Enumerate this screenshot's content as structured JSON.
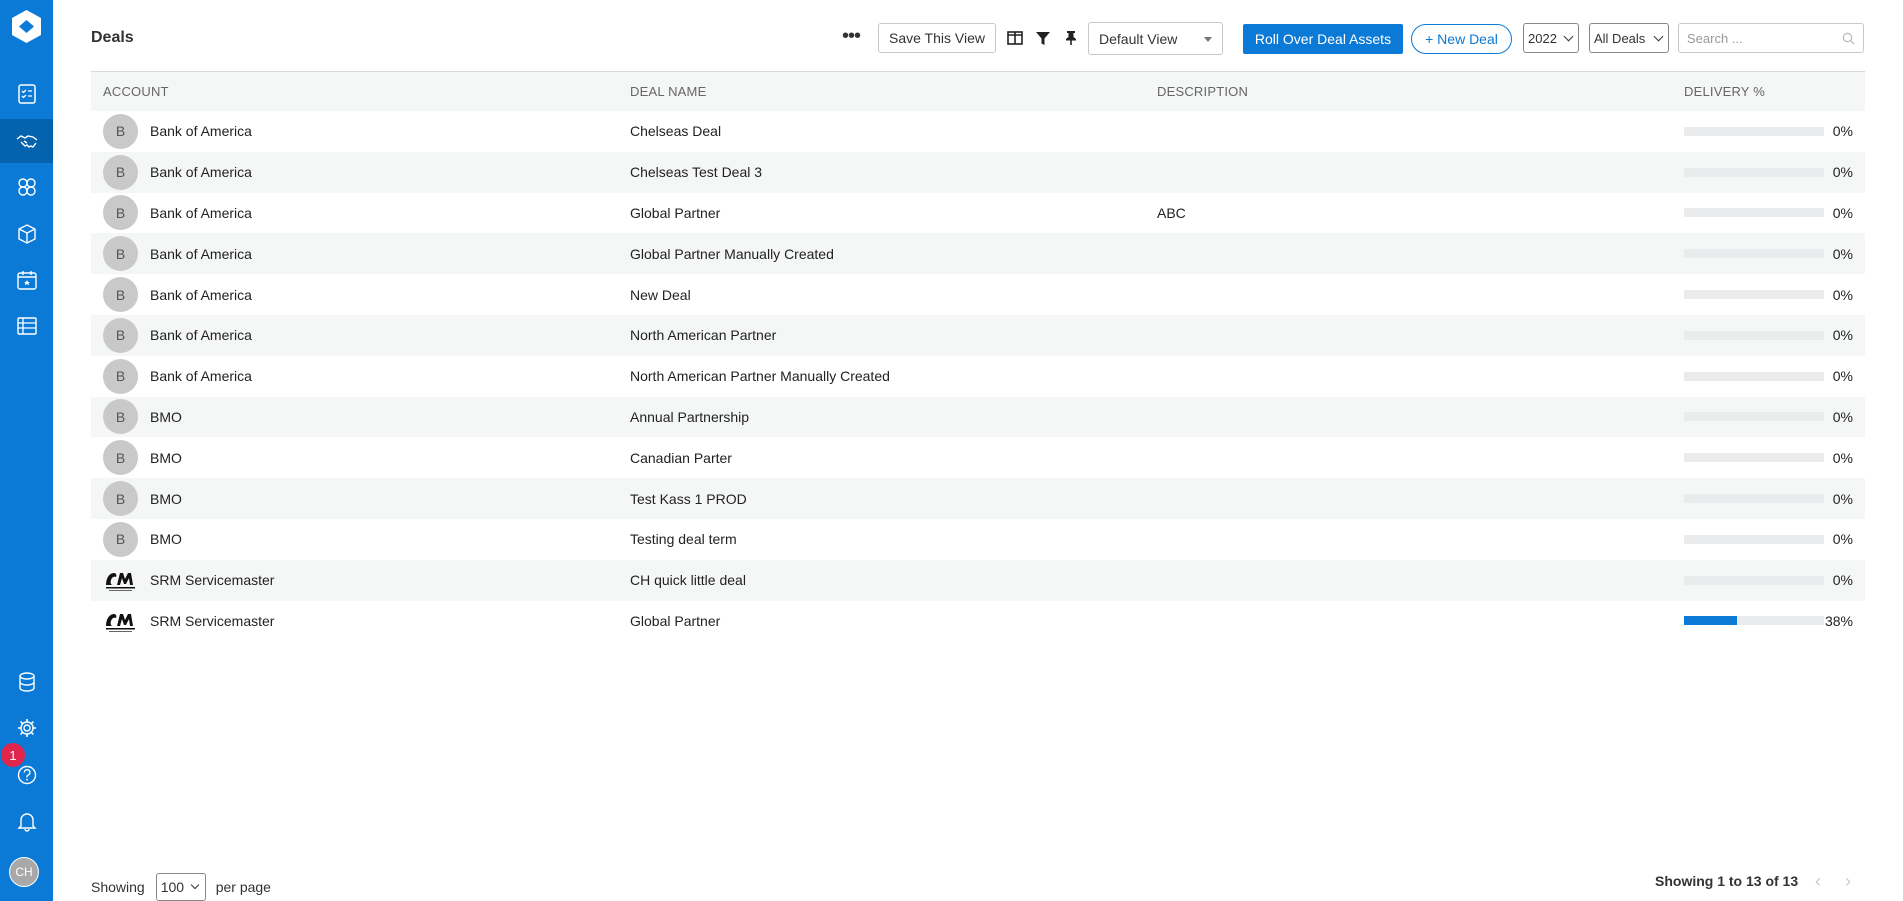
{
  "page": {
    "title": "Deals"
  },
  "sidebar": {
    "icons": [
      "checklist-icon",
      "handshake-icon",
      "accounts-icon",
      "assets-icon",
      "calendar-icon",
      "list-icon",
      "database-icon",
      "gear-icon",
      "help-icon",
      "bell-icon"
    ],
    "badge_count": "1",
    "user_initials": "CH",
    "accent": "#0a7ad6"
  },
  "toolbar": {
    "more_label": "•••",
    "save_view_label": "Save This View",
    "view_select": "Default View",
    "roll_over_label": "Roll Over Deal Assets",
    "new_deal_label": "+ New Deal",
    "year_select": "2022",
    "scope_select": "All Deals",
    "search_placeholder": "Search ..."
  },
  "table": {
    "headers": {
      "account": "ACCOUNT",
      "deal_name": "DEAL NAME",
      "description": "DESCRIPTION",
      "delivery": "DELIVERY %"
    },
    "rows": [
      {
        "avatar": "B",
        "account": "Bank of America",
        "deal": "Chelseas Deal",
        "description": "",
        "delivery": 0,
        "delivery_label": "0%"
      },
      {
        "avatar": "B",
        "account": "Bank of America",
        "deal": "Chelseas Test Deal 3",
        "description": "",
        "delivery": 0,
        "delivery_label": "0%"
      },
      {
        "avatar": "B",
        "account": "Bank of America",
        "deal": "Global Partner",
        "description": "ABC",
        "delivery": 0,
        "delivery_label": "0%"
      },
      {
        "avatar": "B",
        "account": "Bank of America",
        "deal": "Global Partner Manually Created",
        "description": "",
        "delivery": 0,
        "delivery_label": "0%"
      },
      {
        "avatar": "B",
        "account": "Bank of America",
        "deal": "New Deal",
        "description": "",
        "delivery": 0,
        "delivery_label": "0%"
      },
      {
        "avatar": "B",
        "account": "Bank of America",
        "deal": "North American Partner",
        "description": "",
        "delivery": 0,
        "delivery_label": "0%"
      },
      {
        "avatar": "B",
        "account": "Bank of America",
        "deal": "North American Partner Manually Created",
        "description": "",
        "delivery": 0,
        "delivery_label": "0%"
      },
      {
        "avatar": "B",
        "account": "BMO",
        "deal": "Annual Partnership",
        "description": "",
        "delivery": 0,
        "delivery_label": "0%"
      },
      {
        "avatar": "B",
        "account": "BMO",
        "deal": "Canadian Parter",
        "description": "",
        "delivery": 0,
        "delivery_label": "0%"
      },
      {
        "avatar": "B",
        "account": "BMO",
        "deal": "Test Kass 1 PROD",
        "description": "",
        "delivery": 0,
        "delivery_label": "0%"
      },
      {
        "avatar": "B",
        "account": "BMO",
        "deal": "Testing deal term",
        "description": "",
        "delivery": 0,
        "delivery_label": "0%"
      },
      {
        "avatar": "logo",
        "account": "SRM Servicemaster",
        "deal": "CH quick little deal",
        "description": "",
        "delivery": 0,
        "delivery_label": "0%"
      },
      {
        "avatar": "logo",
        "account": "SRM Servicemaster",
        "deal": "Global Partner",
        "description": "",
        "delivery": 38,
        "delivery_label": "38%"
      }
    ]
  },
  "footer": {
    "showing_label": "Showing",
    "per_page_value": "100",
    "per_page_label": "per page",
    "summary": "Showing 1 to 13 of 13",
    "prev": "‹",
    "next": "›"
  }
}
